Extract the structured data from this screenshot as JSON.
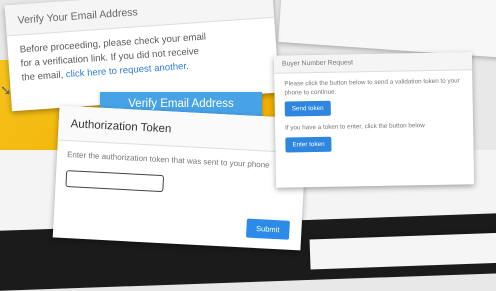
{
  "verify_email_card": {
    "title": "Verify Your Email Address",
    "line1": "Before proceeding, please check your email",
    "line2": "for a verification link. If you did not receive",
    "line3_prefix": "the email, ",
    "link_text": "click here to request another",
    "line3_suffix": "."
  },
  "verify_button_label": "Verify Email Address",
  "authorization_card": {
    "title": "Authorization Token",
    "instruction": "Enter the authorization token that was sent to your phone",
    "input_value": "",
    "submit_label": "Submit"
  },
  "buyer_card": {
    "title": "Buyer Number Request",
    "instruction1": "Please click the button below to send a validation token to your phone to continue.",
    "send_label": "Send token",
    "instruction2": "If you have a token to enter, click the button below",
    "enter_label": "Enter token"
  },
  "colors": {
    "primary_button": "#2e86de",
    "verify_button": "#47a3e6",
    "background_yellow": "#f2b100",
    "link": "#2f7fd6"
  }
}
